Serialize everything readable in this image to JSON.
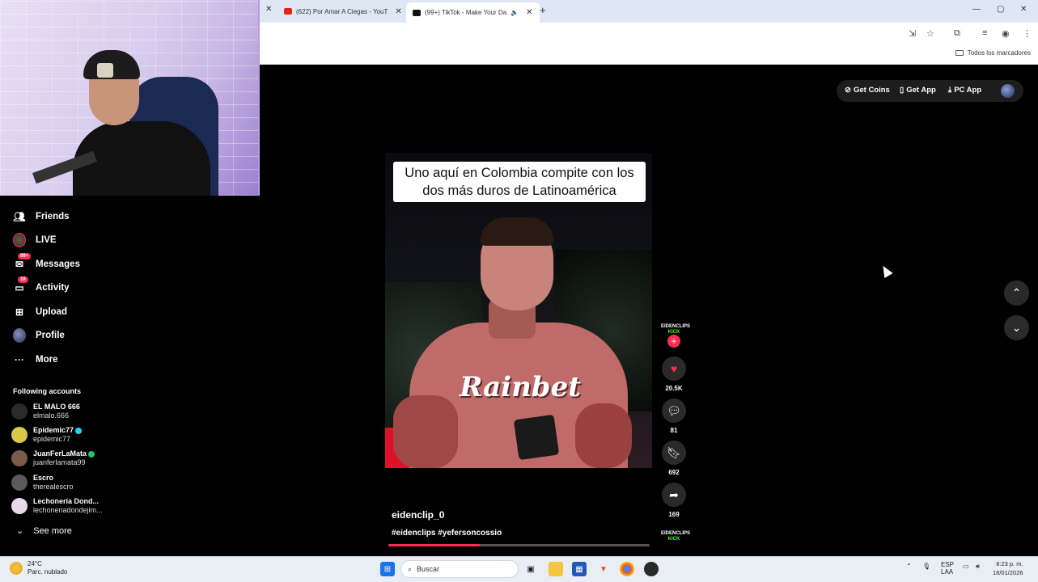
{
  "browser": {
    "tabs": [
      {
        "title": "(622) Por Amar A Ciegas - YouT",
        "active": false
      },
      {
        "title": "(99+) TikTok - Make Your Da",
        "active": true
      }
    ],
    "bookmarks_label": "Todos los marcadores"
  },
  "top_actions": {
    "get_coins": "Get Coins",
    "get_app": "Get App",
    "pc_app": "PC App"
  },
  "sidebar": {
    "items": [
      {
        "label": "Friends",
        "icon": "friends-icon"
      },
      {
        "label": "LIVE",
        "icon": "live-avatar"
      },
      {
        "label": "Messages",
        "icon": "messages-icon",
        "badge": "99+"
      },
      {
        "label": "Activity",
        "icon": "activity-icon",
        "badge": "19"
      },
      {
        "label": "Upload",
        "icon": "upload-icon"
      },
      {
        "label": "Profile",
        "icon": "profile-avatar"
      },
      {
        "label": "More",
        "icon": "more-icon"
      }
    ],
    "following_title": "Following accounts",
    "accounts": [
      {
        "name": "EL MALO 666",
        "handle": "elmalo.666",
        "color": "#2a2a2a"
      },
      {
        "name": "Epidemic77",
        "handle": "epidemic77",
        "verified": "blue",
        "color": "#d8c84a"
      },
      {
        "name": "JuanFerLaMata",
        "handle": "juanferlamata99",
        "verified": "green",
        "color": "#7a5a4a"
      },
      {
        "name": "Escro",
        "handle": "therealescro",
        "color": "#5a5a5a"
      },
      {
        "name": "Lechonería Dond...",
        "handle": "lechoneriadondejim...",
        "color": "#e8d8e8"
      }
    ],
    "see_more": "See more"
  },
  "video": {
    "caption": "Uno aquí en Colombia compite con los dos más duros de Latinoamérica",
    "brand_text": "Rainbet",
    "author": "eidenclip_0",
    "tags": "#eidenclips #yefersoncossio",
    "progress": 0.35,
    "creator_badge_line1": "EIDENCLIPS",
    "creator_badge_line2": "KICK"
  },
  "actions": {
    "likes": "20.5K",
    "comments": "81",
    "saves": "692",
    "shares": "169"
  },
  "taskbar": {
    "temperature": "24°C",
    "weather": "Parc. nublado",
    "search_placeholder": "Buscar",
    "lang_line1": "ESP",
    "lang_line2": "LAA",
    "time": "8:23 p. m.",
    "date": "18/01/2026"
  },
  "colors": {
    "accent": "#fe2c55",
    "kick_green": "#53fc18"
  }
}
